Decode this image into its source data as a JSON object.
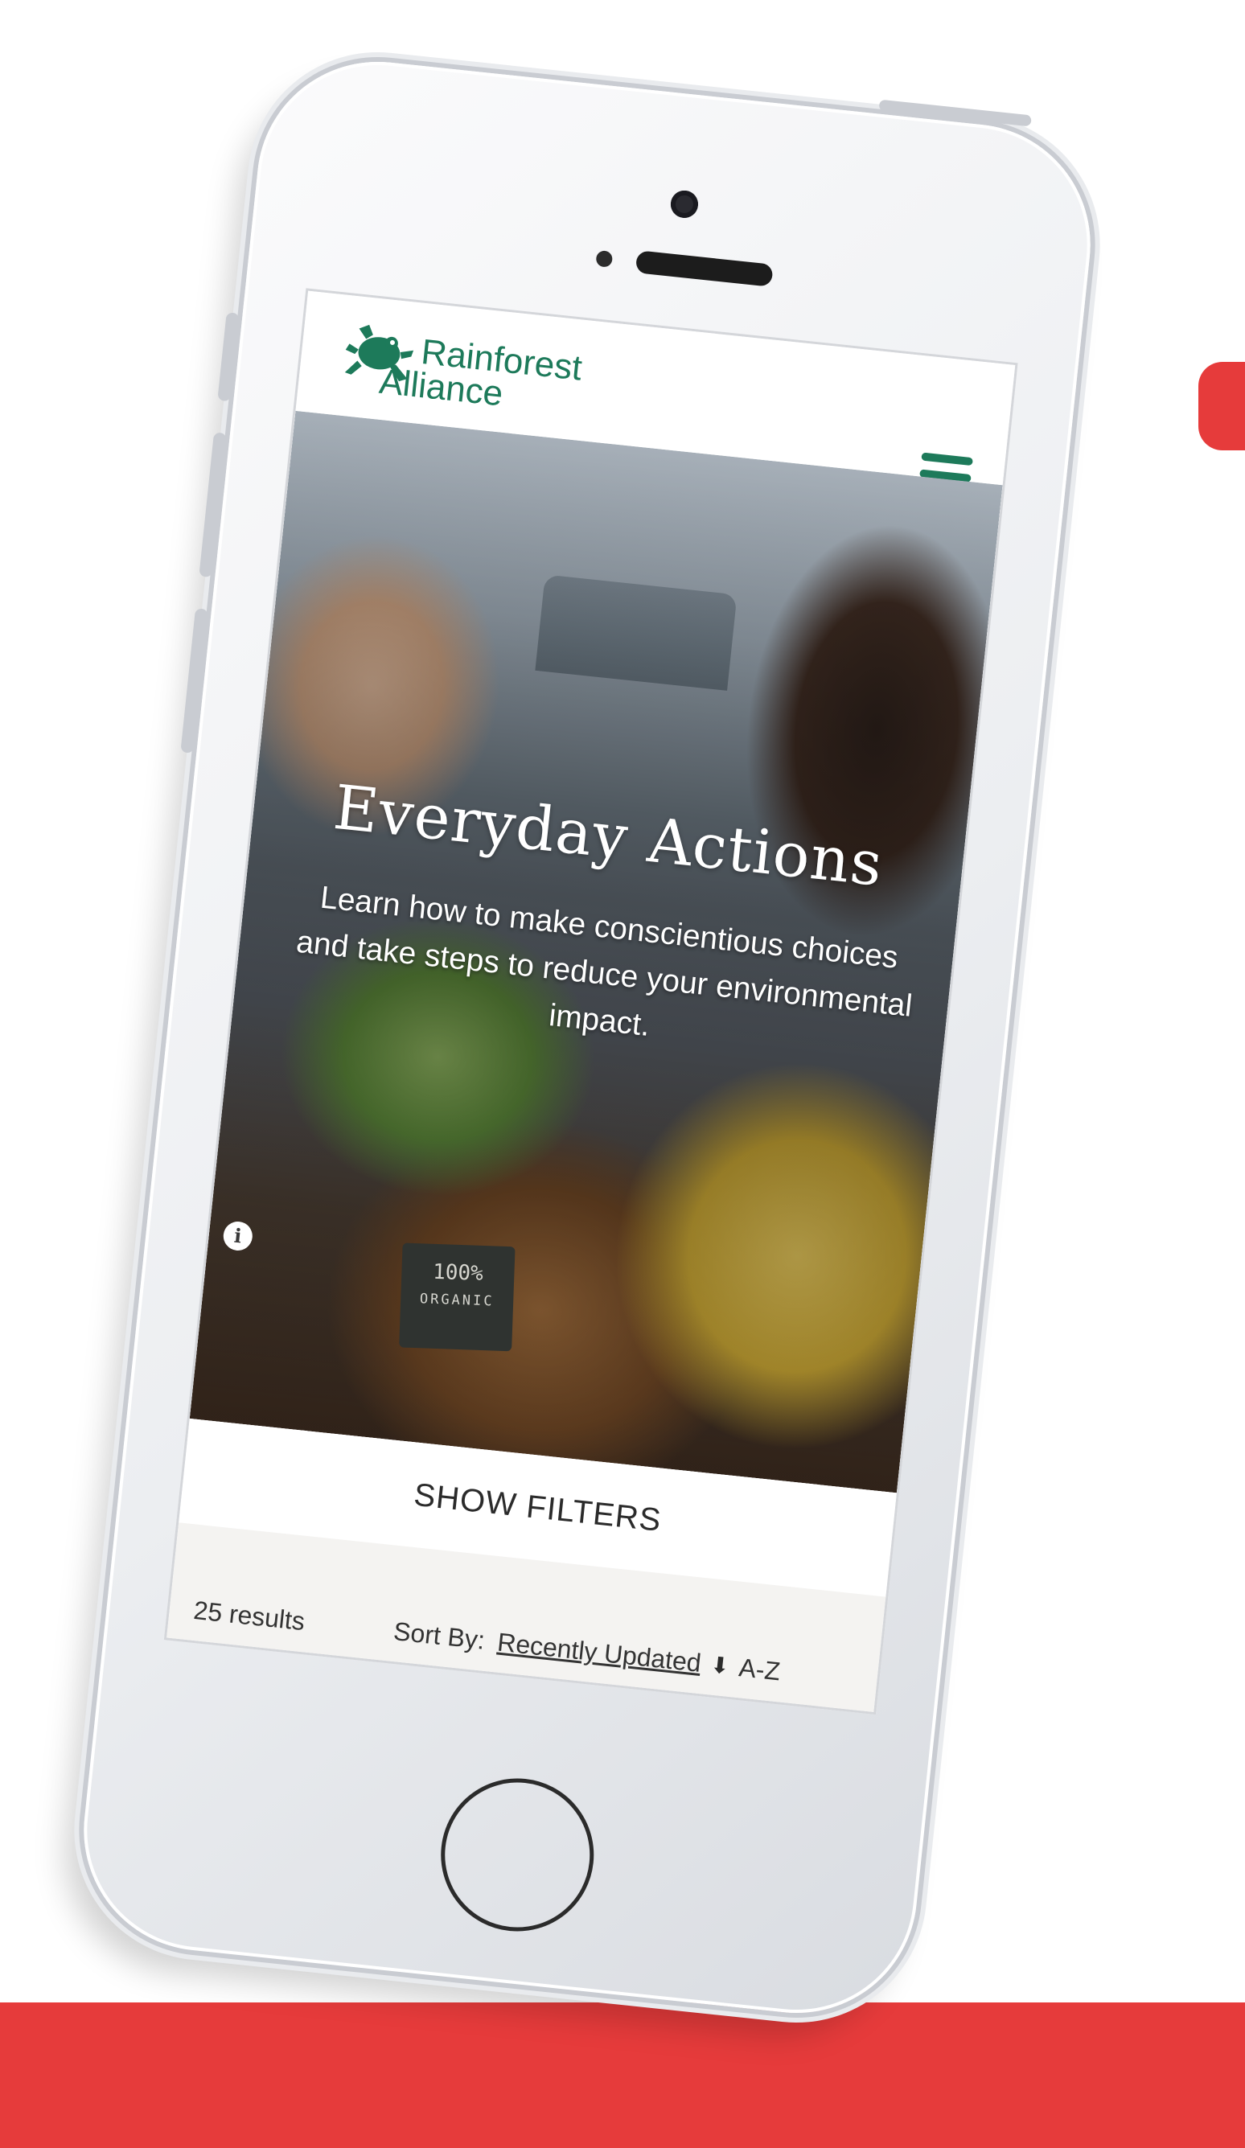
{
  "header": {
    "brand_line1": "Rainforest",
    "brand_line2": "Alliance",
    "icons": {
      "logo": "frog-icon",
      "menu": "hamburger-menu-icon"
    }
  },
  "hero": {
    "title": "Everyday Actions",
    "subtitle": "Learn how to make conscientious choices and take steps to reduce your environmental impact.",
    "chalkboard_line1": "100%",
    "chalkboard_line2": "ORGANIC",
    "info_icon": "i"
  },
  "filters": {
    "label": "SHOW FILTERS"
  },
  "results": {
    "count_text": "25 results",
    "sort_label": "Sort By:",
    "sort_options": [
      "Recently Updated",
      "A-Z"
    ],
    "sort_direction_icon": "down-arrow-icon"
  },
  "colors": {
    "brand_green": "#1d7a5a",
    "accent_red": "#e63b3b",
    "results_bar": "#f4f3f1"
  }
}
